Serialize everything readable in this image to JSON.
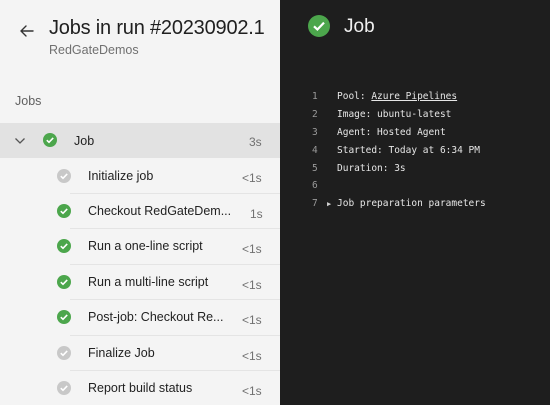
{
  "header": {
    "title": "Jobs in run #20230902.1",
    "subtitle": "RedGateDemos"
  },
  "sidebar": {
    "section_label": "Jobs",
    "job": {
      "label": "Job",
      "duration": "3s",
      "status": "success"
    },
    "steps": [
      {
        "label": "Initialize job",
        "duration": "<1s",
        "status": "skipped"
      },
      {
        "label": "Checkout RedGateDem...",
        "duration": "1s",
        "status": "success"
      },
      {
        "label": "Run a one-line script",
        "duration": "<1s",
        "status": "success"
      },
      {
        "label": "Run a multi-line script",
        "duration": "<1s",
        "status": "success"
      },
      {
        "label": "Post-job: Checkout Re...",
        "duration": "<1s",
        "status": "success"
      },
      {
        "label": "Finalize Job",
        "duration": "<1s",
        "status": "skipped"
      },
      {
        "label": "Report build status",
        "duration": "<1s",
        "status": "skipped"
      }
    ]
  },
  "detail": {
    "title": "Job",
    "log": [
      {
        "num": "1",
        "prefix": "Pool: ",
        "link": "Azure Pipelines"
      },
      {
        "num": "2",
        "text": "Image: ubuntu-latest"
      },
      {
        "num": "3",
        "text": "Agent: Hosted Agent"
      },
      {
        "num": "4",
        "text": "Started: Today at 6:34 PM"
      },
      {
        "num": "5",
        "text": "Duration: 3s"
      },
      {
        "num": "6",
        "text": ""
      },
      {
        "num": "7",
        "text": "Job preparation parameters",
        "collapsible": true
      }
    ]
  },
  "colors": {
    "success": "#4ca64c",
    "skipped": "#c8c8c8",
    "panel_left": "#f4f4f4",
    "panel_right": "#1e1e1e"
  }
}
